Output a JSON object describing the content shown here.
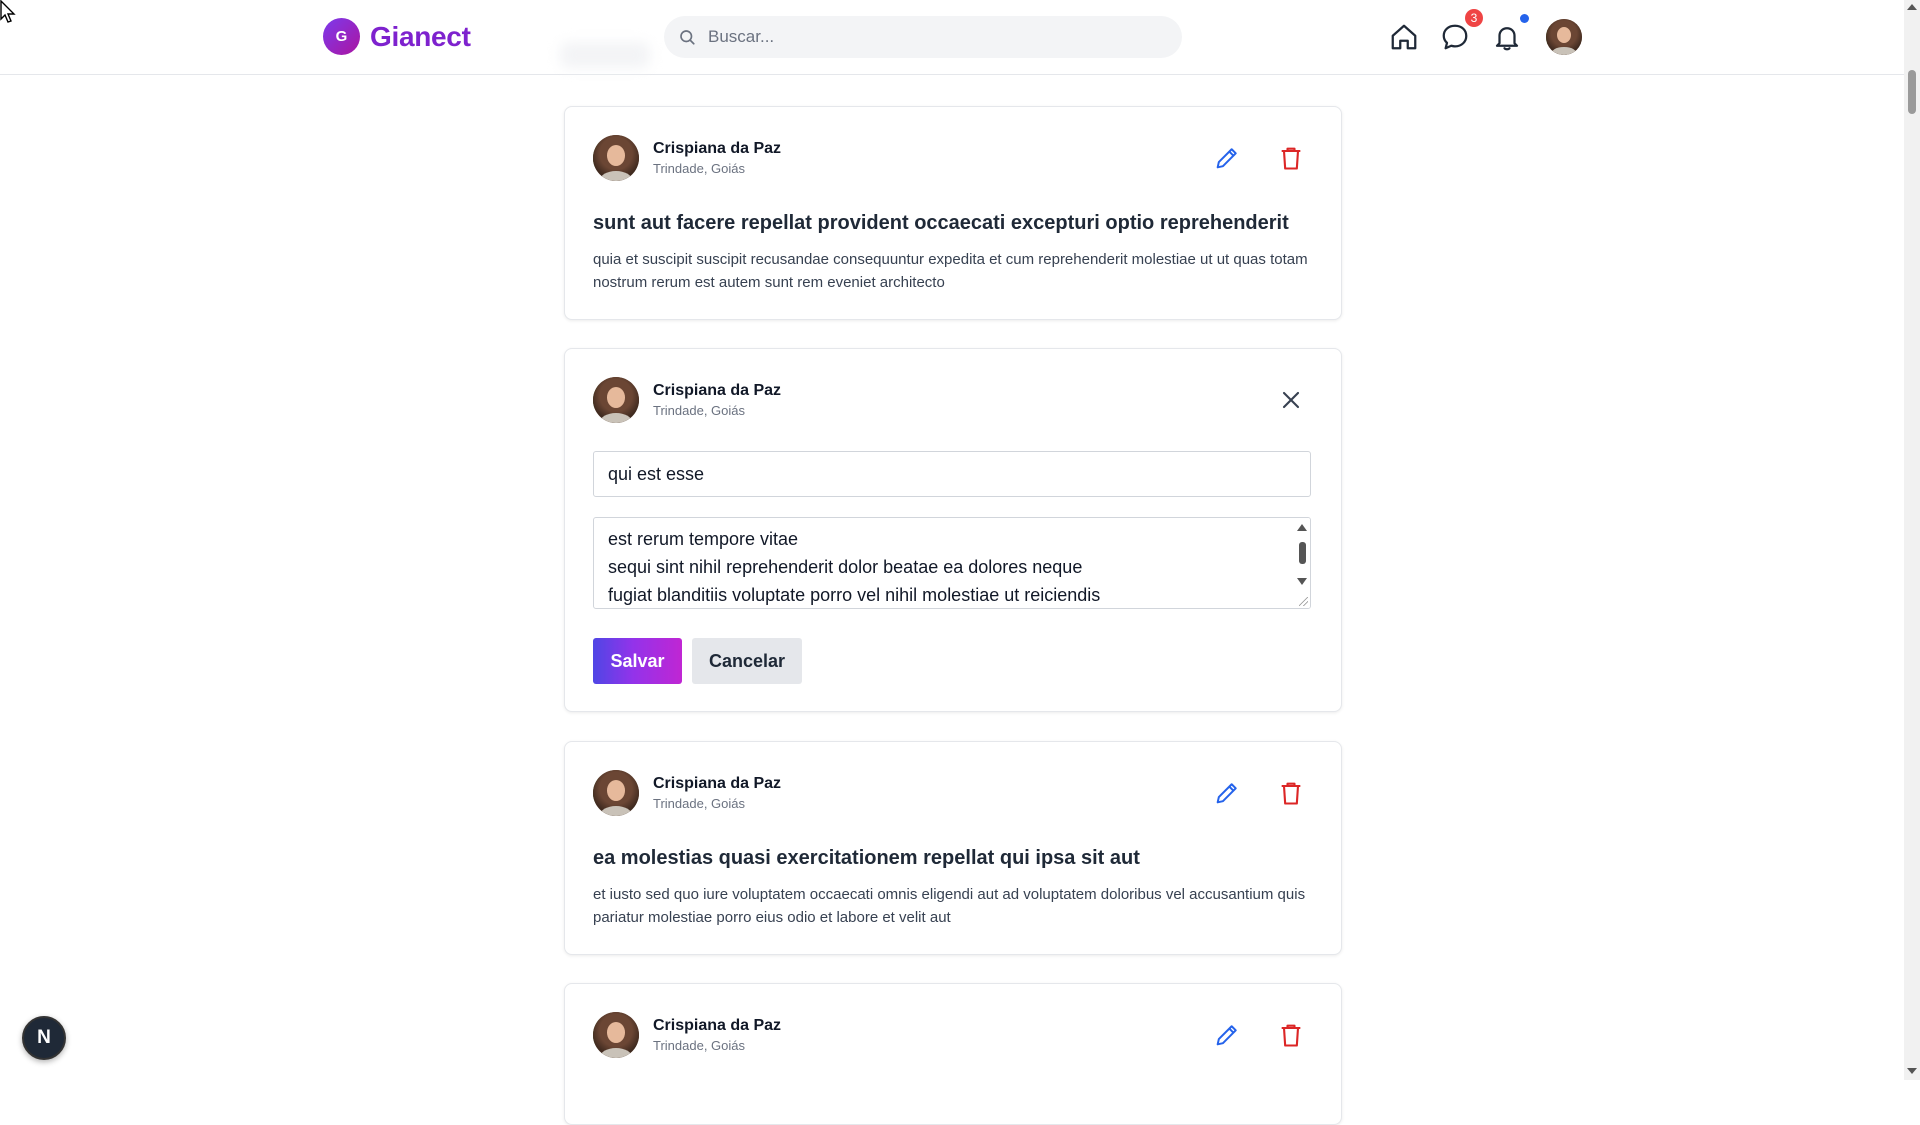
{
  "header": {
    "brand_mark": "G",
    "brand_name": "Gianect",
    "search_placeholder": "Buscar...",
    "messages_badge": "3",
    "icons": [
      "home-icon",
      "chat-icon",
      "bell-icon"
    ]
  },
  "colors": {
    "brand": "#7e22ce",
    "edit": "#2563eb",
    "delete": "#dc2626",
    "badge": "#ef4444"
  },
  "posts": [
    {
      "author": "Crispiana da Paz",
      "location": "Trindade, Goiás",
      "title": "sunt aut facere repellat provident occaecati excepturi optio reprehenderit",
      "body": "quia et suscipit suscipit recusandae consequuntur expedita et cum reprehenderit molestiae ut ut quas totam nostrum rerum est autem sunt rem eveniet architecto"
    },
    {
      "author": "Crispiana da Paz",
      "location": "Trindade, Goiás",
      "editing": true,
      "title_value": "qui est esse",
      "body_lines": [
        "est rerum tempore vitae",
        "sequi sint nihil reprehenderit dolor beatae ea dolores neque",
        "fugiat blanditiis voluptate porro vel nihil molestiae ut reiciendis"
      ],
      "save_label": "Salvar",
      "cancel_label": "Cancelar"
    },
    {
      "author": "Crispiana da Paz",
      "location": "Trindade, Goiás",
      "title": "ea molestias quasi exercitationem repellat qui ipsa sit aut",
      "body": "et iusto sed quo iure voluptatem occaecati omnis eligendi aut ad voluptatem doloribus vel accusantium quis pariatur molestiae porro eius odio et labore et velit aut"
    },
    {
      "author": "Crispiana da Paz",
      "location": "Trindade, Goiás"
    }
  ],
  "dev_badge": "N"
}
